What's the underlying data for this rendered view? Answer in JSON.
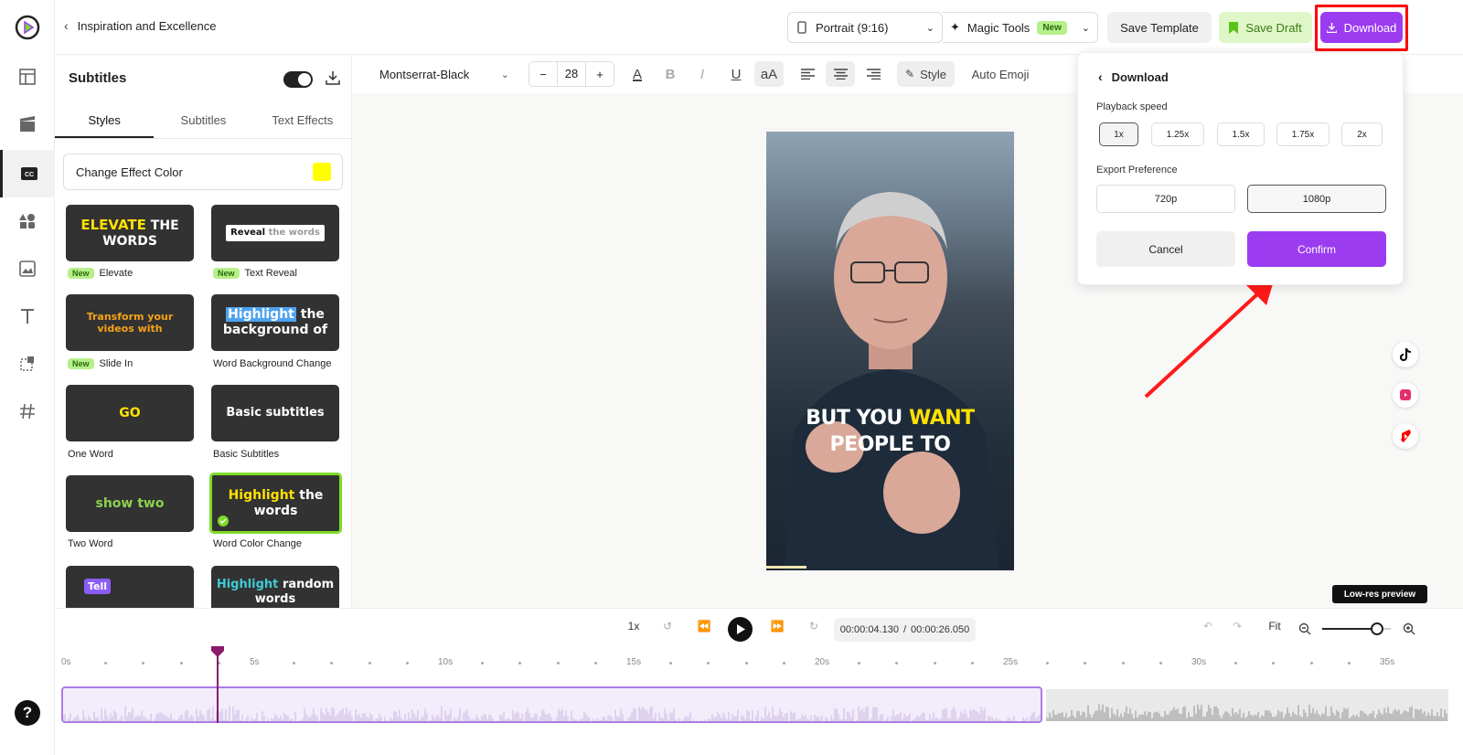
{
  "header": {
    "back_label": "Inspiration and Excellence",
    "aspect": "Portrait (9:16)",
    "magic_tools": "Magic Tools",
    "new_badge": "New",
    "save_template": "Save Template",
    "save_draft": "Save Draft",
    "download": "Download"
  },
  "colors": {
    "accent": "#9b3cf0",
    "highlight_box": "#ff0000",
    "draft_bg": "#dff7c8",
    "effect_color": "#ffff00"
  },
  "sidebar": {
    "icons": [
      "logo-icon",
      "layout-icon",
      "media-icon",
      "captions-icon",
      "elements-icon",
      "image-icon",
      "text-icon",
      "crop-icon",
      "hashtag-icon",
      "help-icon"
    ],
    "help_label": "?"
  },
  "panel": {
    "title": "Subtitles",
    "tabs": [
      "Styles",
      "Subtitles",
      "Text Effects"
    ],
    "effect_color_label": "Change Effect Color",
    "styles": [
      {
        "name": "Elevate",
        "new": true,
        "preview_a": "ELEVATE",
        "preview_b": "THE WORDS"
      },
      {
        "name": "Text Reveal",
        "new": true,
        "preview_a": "Reveal",
        "preview_b": "the words"
      },
      {
        "name": "Slide In",
        "new": true,
        "preview_a": "Transform your videos with"
      },
      {
        "name": "Word Background Change",
        "new": false,
        "preview_a": "Highlight",
        "preview_b": "the background of"
      },
      {
        "name": "One Word",
        "new": false,
        "preview_a": "GO"
      },
      {
        "name": "Basic Subtitles",
        "new": false,
        "preview_a": "Basic subtitles"
      },
      {
        "name": "Two Word",
        "new": false,
        "preview_a": "show two"
      },
      {
        "name": "Word Color Change",
        "new": false,
        "preview_a": "Highlight",
        "preview_b": "the words",
        "selected": true
      },
      {
        "name": "",
        "new": false,
        "preview_a": "Tell"
      },
      {
        "name": "",
        "new": false,
        "preview_a": "Highlight",
        "preview_b": "random words"
      }
    ]
  },
  "toolbar": {
    "font": "Montserrat-Black",
    "size": "28",
    "minus": "−",
    "plus": "+",
    "text_color_glyph": "A",
    "bold": "B",
    "italic": "I",
    "underline": "U",
    "case": "aA",
    "style_label": "Style",
    "auto_emoji": "Auto Emoji"
  },
  "canvas": {
    "subtitle_line1_a": "BUT YOU",
    "subtitle_line1_b": "WANT",
    "subtitle_line2": "PEOPLE TO",
    "low_res": "Low-res preview",
    "social": [
      "tiktok-icon",
      "instagram-reels-icon",
      "youtube-shorts-icon"
    ]
  },
  "download_popover": {
    "title": "Download",
    "playback_label": "Playback speed",
    "speeds": [
      "1x",
      "1.25x",
      "1.5x",
      "1.75x",
      "2x"
    ],
    "selected_speed": "1x",
    "export_label": "Export Preference",
    "resolutions": [
      "720p",
      "1080p"
    ],
    "selected_resolution": "1080p",
    "cancel": "Cancel",
    "confirm": "Confirm"
  },
  "timeline": {
    "speed": "1x",
    "time_current": "00:00:04.130",
    "time_sep": "/",
    "time_total": "00:00:26.050",
    "fit": "Fit",
    "zoom_level": 0.8,
    "ticks": [
      "0s",
      "5s",
      "10s",
      "15s",
      "20s",
      "25s",
      "30s",
      "35s"
    ],
    "playhead_seconds": 4.13
  }
}
